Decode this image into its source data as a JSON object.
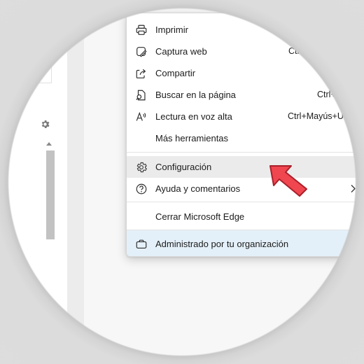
{
  "menu": {
    "items": [
      {
        "label": "Imprimir",
        "icon": "printer-icon",
        "shortcut": "",
        "submenu": false
      },
      {
        "label": "Captura web",
        "icon": "web-capture-icon",
        "shortcut": "Ctrl+",
        "submenu": false
      },
      {
        "label": "Compartir",
        "icon": "share-icon",
        "shortcut": "",
        "submenu": false
      },
      {
        "label": "Buscar en la página",
        "icon": "find-icon",
        "shortcut": "Ctrl+F",
        "submenu": false
      },
      {
        "label": "Lectura en voz alta",
        "icon": "read-aloud-icon",
        "shortcut": "Ctrl+Mayús+U",
        "submenu": false
      },
      {
        "label": "Más herramientas",
        "icon": "",
        "shortcut": "",
        "submenu": true
      },
      {
        "label": "Configuración",
        "icon": "gear-icon",
        "shortcut": "",
        "submenu": false,
        "highlighted": true
      },
      {
        "label": "Ayuda y comentarios",
        "icon": "help-icon",
        "shortcut": "",
        "submenu": true
      },
      {
        "label": "Cerrar Microsoft Edge",
        "icon": "",
        "shortcut": "",
        "submenu": false
      },
      {
        "label": "Administrado por tu organización",
        "icon": "briefcase-icon",
        "shortcut": "",
        "submenu": false
      }
    ]
  },
  "colors": {
    "hover_row": "#ebebeb",
    "managed_row": "#e4f0f9",
    "pointer_arrow": "#f04650"
  }
}
